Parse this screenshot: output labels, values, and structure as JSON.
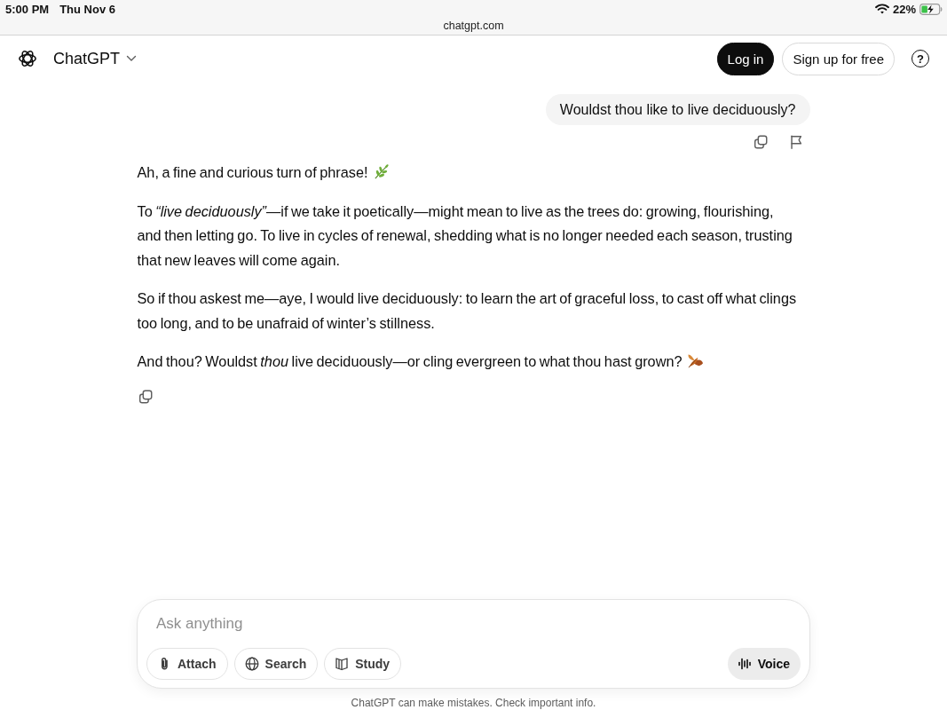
{
  "status_bar": {
    "time": "5:00 PM",
    "date": "Thu Nov 6",
    "battery": "22%"
  },
  "address_bar": {
    "url": "chatgpt.com"
  },
  "header": {
    "title": "ChatGPT",
    "buttons": [
      {
        "label": "Log in",
        "kind": "primary"
      },
      {
        "label": "Sign up for free",
        "kind": "outline"
      }
    ],
    "help_button": "?"
  },
  "conversation": {
    "user_message": "Wouldst thou like to live deciduously?",
    "assistant_paragraphs": [
      {
        "kind": "herb",
        "text": "Ah, a fine and curious turn of phrase!"
      },
      {
        "kind": "plain",
        "text": "To *“live deciduously”*—if we take it poetically—might mean to live as the trees do: growing, flourishing, and then letting go. To live in cycles of renewal, shedding what is no longer needed each season, trusting that new leaves will come again."
      },
      {
        "kind": "plain",
        "text": "So if thou askest me—aye, I would live deciduously: to learn the art of graceful loss, to cast off what clings too long, and to be unafraid of winter’s stillness."
      },
      {
        "kind": "leaf",
        "text": "And thou? Wouldst *thou* live deciduously—or cling evergreen to what thou hast grown?"
      }
    ]
  },
  "composer": {
    "placeholder": "Ask anything",
    "tools": [
      {
        "kind": "attach",
        "label": "Attach"
      },
      {
        "kind": "search",
        "label": "Search"
      },
      {
        "kind": "study",
        "label": "Study"
      }
    ],
    "voice_button": "Voice"
  },
  "disclaimer": "ChatGPT can make mistakes. Check important info."
}
